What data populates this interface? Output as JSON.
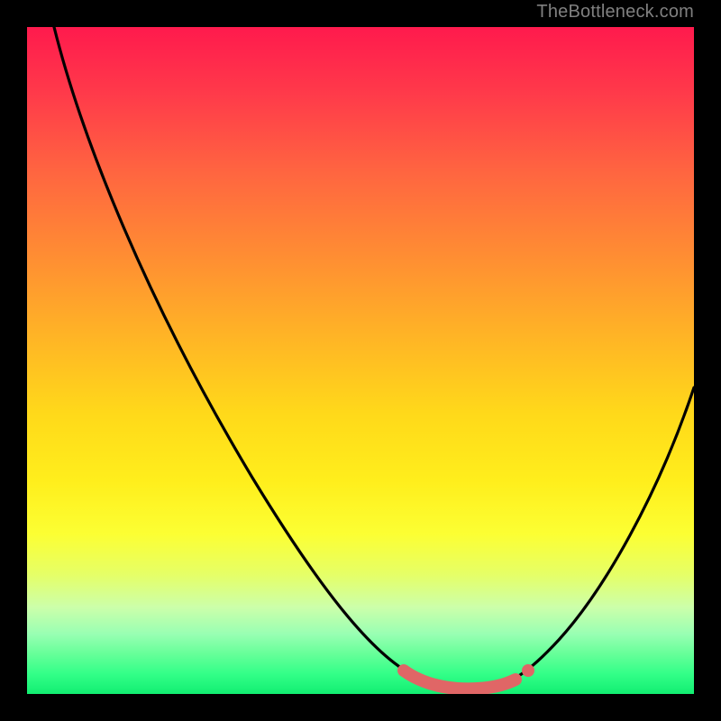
{
  "watermark": "TheBottleneck.com",
  "colors": {
    "frame": "#000000",
    "curve": "#000000",
    "marker_fill": "#e06666",
    "marker_stroke": "#c05050"
  },
  "chart_data": {
    "type": "line",
    "title": "",
    "xlabel": "",
    "ylabel": "",
    "xlim": [
      0,
      100
    ],
    "ylim": [
      0,
      100
    ],
    "x": [
      4,
      10,
      15,
      20,
      25,
      30,
      35,
      40,
      45,
      50,
      55,
      58,
      60,
      62,
      64,
      66,
      68,
      70,
      72,
      75,
      80,
      85,
      90,
      95,
      100
    ],
    "y": [
      100,
      89,
      80,
      71,
      63,
      55,
      47,
      40,
      33,
      26,
      18,
      13,
      10,
      7,
      5,
      3,
      2,
      2,
      2,
      3,
      7,
      14,
      23,
      33,
      45
    ],
    "gradient_meaning": "vertical color gradient from red (high bottleneck) at top to green (low bottleneck) at bottom",
    "marker_region": {
      "x_start": 58,
      "x_end": 74,
      "description": "thick rounded light-red segment highlighting the flat minimum of the curve, with a small dot at its right end"
    }
  }
}
